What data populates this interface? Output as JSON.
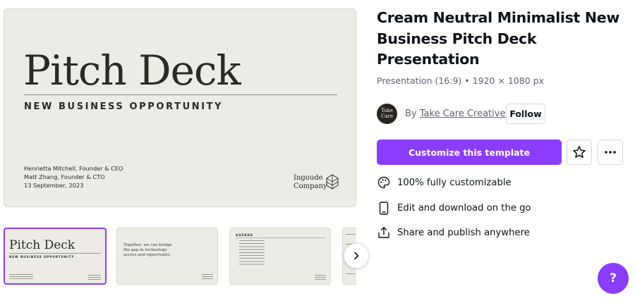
{
  "preview": {
    "title": "Pitch Deck",
    "subtitle": "NEW BUSINESS OPPORTUNITY",
    "presenter_1": "Henrietta Mitchell, Founder & CEO",
    "presenter_2": "Matt Zhang, Founder & CTO",
    "date": "13 September, 2023",
    "company_line_1": "Ingoude",
    "company_line_2": "Company"
  },
  "thumbnails": [
    {
      "title": "Pitch Deck",
      "subtitle": "NEW BUSINESS OPPORTUNITY",
      "selected": true
    },
    {
      "text_1": "Together, we can bridge",
      "text_2": "the gap in technology",
      "text_3": "access and opportunity."
    },
    {
      "heading": "AGENDA"
    },
    {
      "partial": true
    }
  ],
  "template": {
    "title": "Cream Neutral Minimalist New Business Pitch Deck Presentation",
    "meta": "Presentation (16:9) • 1920 × 1080 px"
  },
  "creator": {
    "by_label": "By",
    "name": "Take Care Creative",
    "avatar_line_1": "Take",
    "avatar_line_2": "Care",
    "follow_label": "Follow"
  },
  "actions": {
    "customize_label": "Customize this template",
    "favorite_icon": "star-icon",
    "more_icon": "more-icon"
  },
  "features": [
    {
      "icon": "palette-icon",
      "label": "100% fully customizable"
    },
    {
      "icon": "mobile-icon",
      "label": "Edit and download on the go"
    },
    {
      "icon": "share-icon",
      "label": "Share and publish anywhere"
    }
  ],
  "help": {
    "label": "?"
  },
  "colors": {
    "accent": "#8b3dff",
    "slide_background": "#ecebe5",
    "text": "#0e1318",
    "muted": "#5f6470"
  }
}
